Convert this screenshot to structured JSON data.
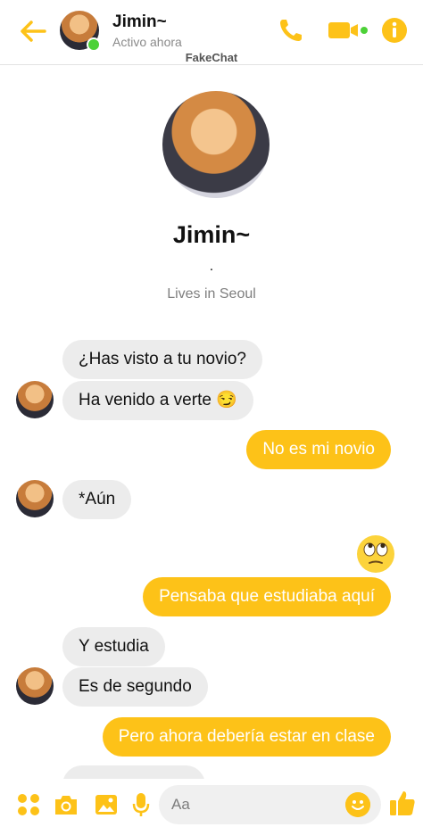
{
  "header": {
    "name": "Jimin~",
    "status": "Activo ahora",
    "watermark": "FakeChat"
  },
  "profile": {
    "name": "Jimin~",
    "dot": ".",
    "location": "Lives in Seoul"
  },
  "messages": [
    {
      "side": "in",
      "text": "¿Has visto a tu novio?"
    },
    {
      "side": "in",
      "text": "Ha venido a verte 😏"
    },
    {
      "side": "out",
      "text": "No es mi novio"
    },
    {
      "side": "in",
      "text": "*Aún"
    },
    {
      "side": "out",
      "text": "Pensaba que estudiaba aquí"
    },
    {
      "side": "in",
      "text": "Y estudia"
    },
    {
      "side": "in",
      "text": "Es de segundo"
    },
    {
      "side": "out",
      "text": "Pero ahora debería estar en clase"
    }
  ],
  "composer": {
    "placeholder": "Aa"
  },
  "colors": {
    "accent": "#fdc218",
    "incoming_bubble": "#ececec",
    "online": "#4cd137"
  },
  "icons": [
    "back-arrow-icon",
    "phone-icon",
    "video-icon",
    "info-icon",
    "apps-icon",
    "camera-icon",
    "image-icon",
    "mic-icon",
    "emoji-icon",
    "thumbs-up-icon",
    "rolling-eyes-emoji"
  ]
}
